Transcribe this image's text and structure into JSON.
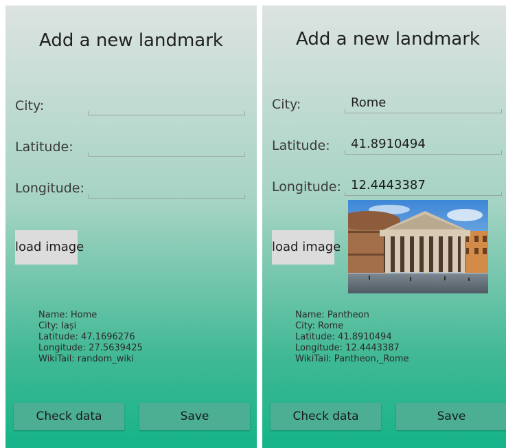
{
  "screens": [
    {
      "title": "Add a new landmark",
      "labels": {
        "city": "City:",
        "latitude": "Latitude:",
        "longitude": "Longitude:"
      },
      "values": {
        "city": "",
        "latitude": "",
        "longitude": ""
      },
      "load_image_label": "load image",
      "info": {
        "name": "Name: Home",
        "city": "City: Iași",
        "latitude": "Latitude: 47.1696276",
        "longitude": "Longitude: 27.5639425",
        "wikitail": "WikiTail: random_wiki"
      },
      "check_label": "Check data",
      "save_label": "Save"
    },
    {
      "title": "Add a new landmark",
      "labels": {
        "city": "City:",
        "latitude": "Latitude:",
        "longitude": "Longitude:"
      },
      "values": {
        "city": "Rome",
        "latitude": "41.8910494",
        "longitude": "12.4443387"
      },
      "load_image_label": "load image",
      "info": {
        "name": "Name: Pantheon",
        "city": "City: Rome",
        "latitude": "Latitude: 41.8910494",
        "longitude": "Longitude: 12.4443387",
        "wikitail": "WikiTail: Pantheon,_Rome"
      },
      "check_label": "Check data",
      "save_label": "Save"
    }
  ],
  "colors": {
    "gradient_top": "#dde3e1",
    "gradient_bottom": "#16b489",
    "button": "#4caf93",
    "load_button": "#dcdcdc"
  }
}
